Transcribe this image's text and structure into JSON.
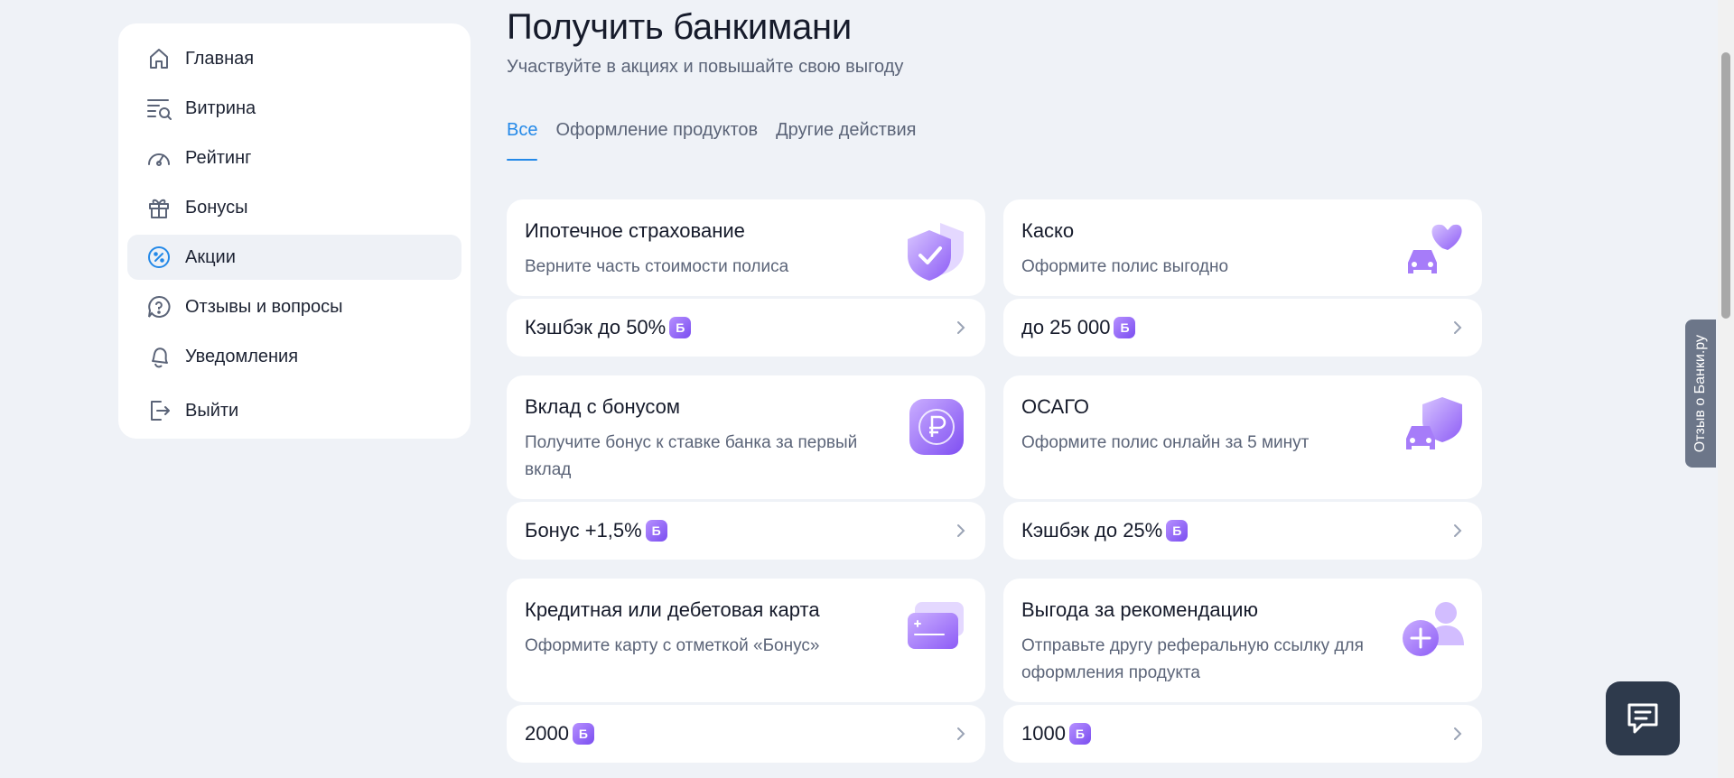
{
  "sidebar": {
    "items": [
      {
        "label": "Главная",
        "icon": "home-icon"
      },
      {
        "label": "Витрина",
        "icon": "showcase-icon"
      },
      {
        "label": "Рейтинг",
        "icon": "speedometer-icon"
      },
      {
        "label": "Бонусы",
        "icon": "gift-icon"
      },
      {
        "label": "Акции",
        "icon": "percent-icon",
        "active": true
      },
      {
        "label": "Отзывы и вопросы",
        "icon": "question-bubble-icon"
      },
      {
        "label": "Уведомления",
        "icon": "bell-icon"
      },
      {
        "label": "Выйти",
        "icon": "logout-icon"
      }
    ]
  },
  "header": {
    "title": "Получить банкимани",
    "subtitle": "Участвуйте в акциях и повышайте свою выгоду"
  },
  "tabs": [
    {
      "label": "Все",
      "active": true
    },
    {
      "label": "Оформление продуктов"
    },
    {
      "label": "Другие действия"
    }
  ],
  "badge_letter": "Б",
  "cards": [
    {
      "title": "Ипотечное страхование",
      "desc": "Верните часть стоимости полиса",
      "reward": "Кэшбэк до 50%",
      "icon": "shield-check-icon"
    },
    {
      "title": "Каско",
      "desc": "Оформите полис выгодно",
      "reward": "до 25 000",
      "icon": "car-heart-icon"
    },
    {
      "title": "Вклад с бонусом",
      "desc": "Получите бонус к ставке банка за первый вклад",
      "reward": "Бонус +1,5%",
      "icon": "ruble-coin-icon"
    },
    {
      "title": "ОСАГО",
      "desc": "Оформите полис онлайн за 5 минут",
      "reward": "Кэшбэк до 25%",
      "icon": "car-shield-icon"
    },
    {
      "title": "Кредитная или дебетовая карта",
      "desc": "Оформите карту с отметкой «Бонус»",
      "reward": "2000",
      "icon": "cards-icon"
    },
    {
      "title": "Выгода за рекомендацию",
      "desc": "Отправьте другу реферальную ссылку для оформления продукта",
      "reward": "1000",
      "icon": "user-plus-icon"
    }
  ],
  "feedback_tab": "Отзыв о Банки.ру",
  "colors": {
    "accent": "#2489e8",
    "badge_purple": "#7a4df0",
    "background": "#eff2f7"
  }
}
